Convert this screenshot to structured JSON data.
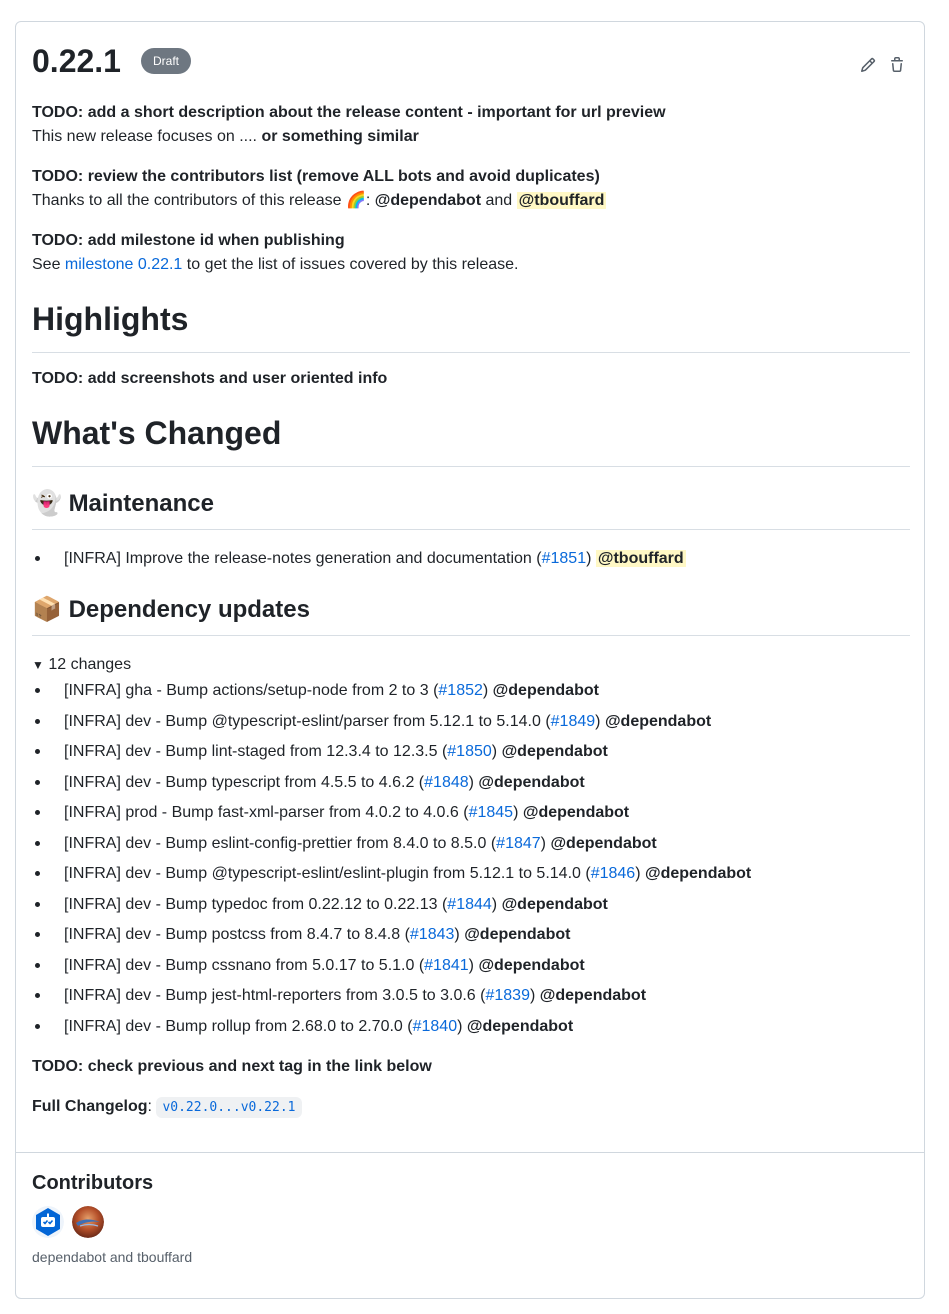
{
  "release": {
    "version": "0.22.1",
    "badge": "Draft",
    "edit_icon": "pencil-icon",
    "delete_icon": "trash-icon"
  },
  "intro": {
    "todo1": "TODO: add a short description about the release content - important for url preview",
    "desc_text": "This new release focuses on .... ",
    "desc_bold": "or something similar",
    "todo2": "TODO: review the contributors list (remove ALL bots and avoid duplicates)",
    "thanks_text": "Thanks to all the contributors of this release ",
    "thanks_emoji": "🌈",
    "thanks_colon": ": ",
    "mention1": "@dependabot",
    "and_text": " and ",
    "mention2": "@tbouffard",
    "todo3": "TODO: add milestone id when publishing",
    "see_text": "See ",
    "milestone_link": "milestone 0.22.1",
    "see_rest": " to get the list of issues covered by this release."
  },
  "highlights": {
    "heading": "Highlights",
    "todo": "TODO: add screenshots and user oriented info"
  },
  "changed": {
    "heading": "What's Changed",
    "maintenance": {
      "emoji": "👻",
      "heading": "Maintenance",
      "item": {
        "text": "[INFRA] Improve the release-notes generation and documentation (",
        "pr": "#1851",
        "close": ") ",
        "author": "@tbouffard"
      }
    },
    "deps": {
      "emoji": "📦",
      "heading": "Dependency updates",
      "summary": "12 changes",
      "items": [
        {
          "text": "[INFRA] gha - Bump actions/setup-node from 2 to 3 (",
          "pr": "#1852",
          "author": "@dependabot"
        },
        {
          "text": "[INFRA] dev - Bump @typescript-eslint/parser from 5.12.1 to 5.14.0 (",
          "pr": "#1849",
          "author": "@dependabot"
        },
        {
          "text": "[INFRA] dev - Bump lint-staged from 12.3.4 to 12.3.5 (",
          "pr": "#1850",
          "author": "@dependabot"
        },
        {
          "text": "[INFRA] dev - Bump typescript from 4.5.5 to 4.6.2 (",
          "pr": "#1848",
          "author": "@dependabot"
        },
        {
          "text": "[INFRA] prod - Bump fast-xml-parser from 4.0.2 to 4.0.6 (",
          "pr": "#1845",
          "author": "@dependabot"
        },
        {
          "text": "[INFRA] dev - Bump eslint-config-prettier from 8.4.0 to 8.5.0 (",
          "pr": "#1847",
          "author": "@dependabot"
        },
        {
          "text": "[INFRA] dev - Bump @typescript-eslint/eslint-plugin from 5.12.1 to 5.14.0 (",
          "pr": "#1846",
          "author": "@dependabot"
        },
        {
          "text": "[INFRA] dev - Bump typedoc from 0.22.12 to 0.22.13 (",
          "pr": "#1844",
          "author": "@dependabot"
        },
        {
          "text": "[INFRA] dev - Bump postcss from 8.4.7 to 8.4.8 (",
          "pr": "#1843",
          "author": "@dependabot"
        },
        {
          "text": "[INFRA] dev - Bump cssnano from 5.0.17 to 5.1.0 (",
          "pr": "#1841",
          "author": "@dependabot"
        },
        {
          "text": "[INFRA] dev - Bump jest-html-reporters from 3.0.5 to 3.0.6 (",
          "pr": "#1839",
          "author": "@dependabot"
        },
        {
          "text": "[INFRA] dev - Bump rollup from 2.68.0 to 2.70.0 (",
          "pr": "#1840",
          "author": "@dependabot"
        }
      ],
      "close": ") "
    }
  },
  "footer": {
    "todo": "TODO: check previous and next tag in the link below",
    "changelog_label": "Full Changelog",
    "colon": ": ",
    "changelog_link": "v0.22.0...v0.22.1"
  },
  "contributors": {
    "heading": "Contributors",
    "names": "dependabot and tbouffard",
    "avatars": [
      "dependabot-avatar",
      "tbouffard-avatar"
    ]
  },
  "colors": {
    "link": "#0969da",
    "highlight": "#fff8c5",
    "badge": "#6e7781",
    "dependabot_blue": "#0366d6"
  }
}
